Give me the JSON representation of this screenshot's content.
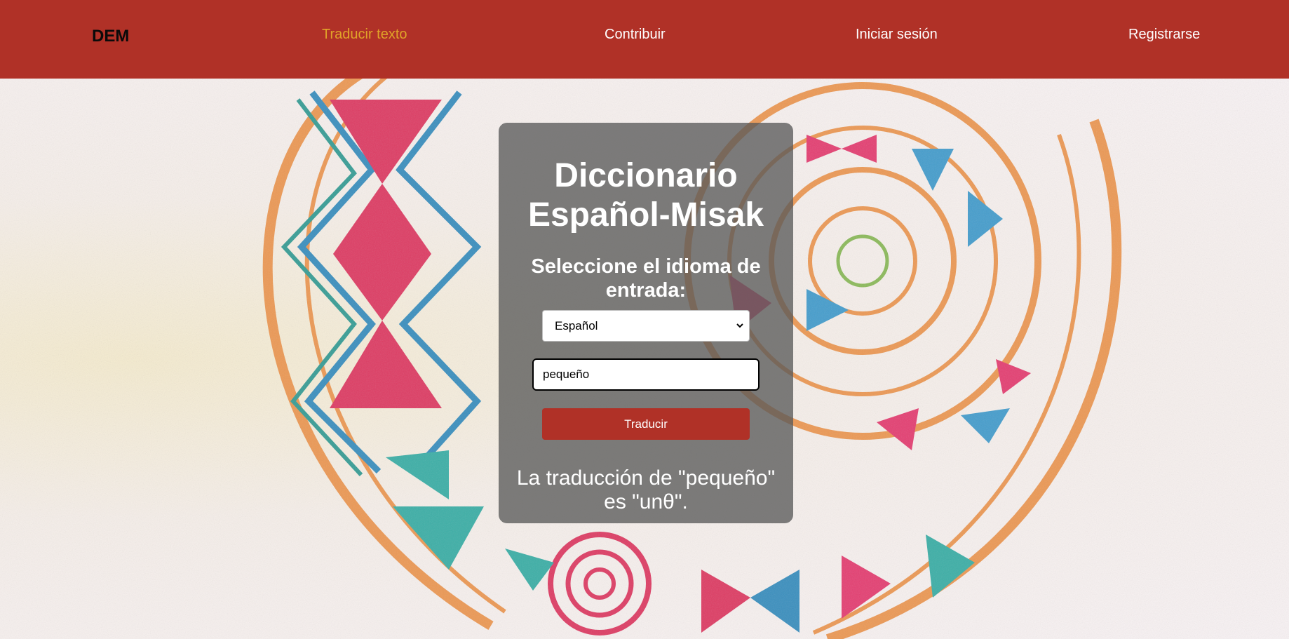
{
  "nav": {
    "brand": "DEM",
    "links": [
      {
        "label": "Traducir texto",
        "active": true
      },
      {
        "label": "Contribuir",
        "active": false
      },
      {
        "label": "Iniciar sesión",
        "active": false
      },
      {
        "label": "Registrarse",
        "active": false
      }
    ]
  },
  "card": {
    "title_line1": "Diccionario",
    "title_line2": "Español-Misak",
    "subtitle_line1": "Seleccione el idioma de",
    "subtitle_line2": "entrada:",
    "language_select": {
      "selected": "Español"
    },
    "word_input": {
      "value": "pequeño"
    },
    "translate_label": "Traducir",
    "result_line1": "La traducción de \"pequeño\"",
    "result_line2": "es \"unθ\"."
  },
  "colors": {
    "header_bg": "#b03127",
    "active_link": "#e0a329",
    "button_bg": "#b03127",
    "card_bg": "rgba(90,90,90,0.78)"
  },
  "icons": {
    "select_arrow": "chevron-down-icon"
  }
}
